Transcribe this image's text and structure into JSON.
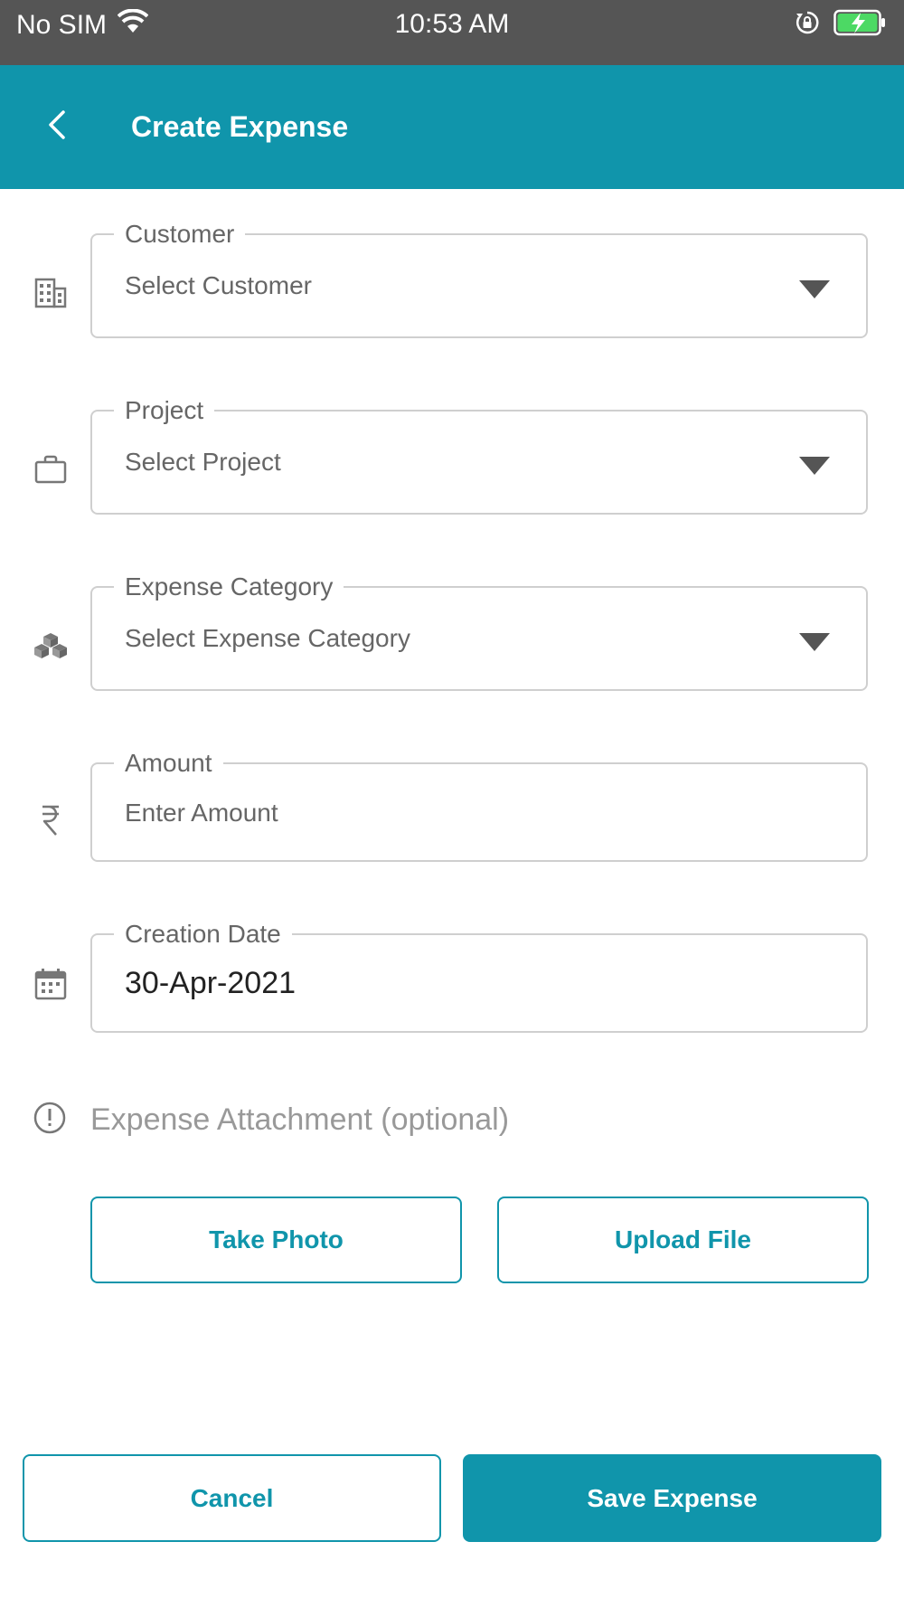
{
  "status_bar": {
    "carrier": "No SIM",
    "time": "10:53 AM",
    "icons": [
      "wifi-icon",
      "rotation-lock-icon",
      "battery-charging-icon"
    ]
  },
  "header": {
    "title": "Create Expense",
    "back_icon": "chevron-left-icon"
  },
  "form": {
    "customer": {
      "label": "Customer",
      "placeholder": "Select Customer",
      "icon": "building-icon"
    },
    "project": {
      "label": "Project",
      "placeholder": "Select Project",
      "icon": "briefcase-icon"
    },
    "category": {
      "label": "Expense Category",
      "placeholder": "Select Expense Category",
      "icon": "cubes-icon"
    },
    "amount": {
      "label": "Amount",
      "placeholder": "Enter Amount",
      "icon": "rupee-icon"
    },
    "date": {
      "label": "Creation Date",
      "value": "30-Apr-2021",
      "icon": "calendar-icon"
    }
  },
  "attachment": {
    "label": "Expense Attachment (optional)",
    "icon": "info-circle-icon",
    "take_photo": "Take Photo",
    "upload_file": "Upload File"
  },
  "actions": {
    "cancel": "Cancel",
    "save": "Save Expense"
  },
  "colors": {
    "primary": "#1095ab",
    "status_bar": "#555555",
    "battery": "#4cd964"
  }
}
